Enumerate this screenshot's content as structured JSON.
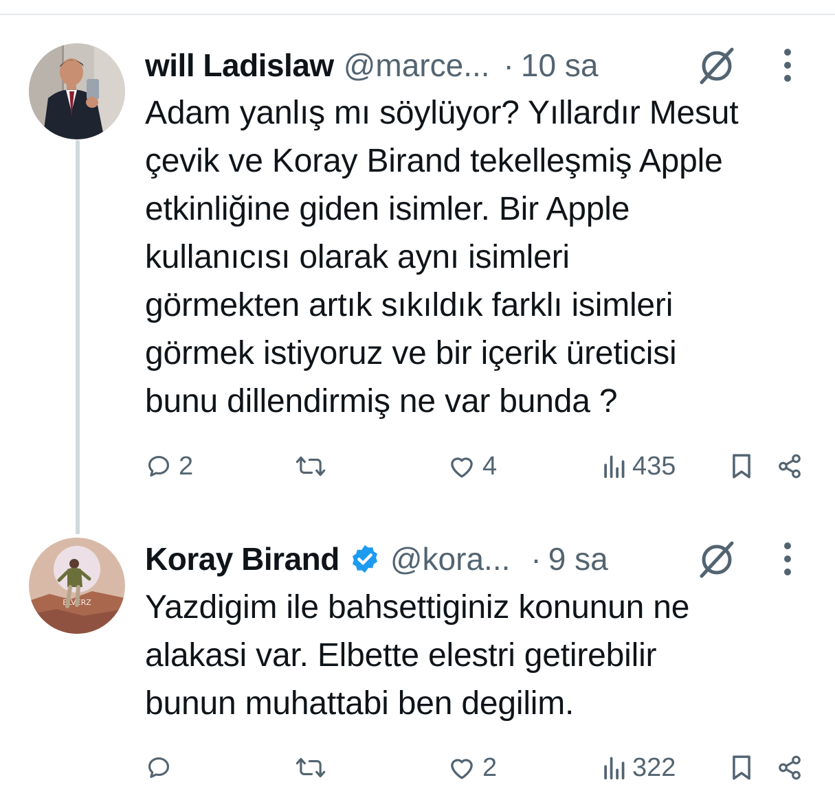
{
  "tweets": [
    {
      "name": "will Ladislaw",
      "handle": "@marce...",
      "dot": "·",
      "time": "10 sa",
      "verified": false,
      "lines": "Adam yanlış mı söylüyor? Yıllardır Mesut\nçevik ve Koray Birand tekelleşmiş Apple\netkinliğine giden isimler. Bir Apple\nkullanıcısı olarak aynı isimleri\ngörmekten artık sıkıldık farklı isimleri\ngörmek istiyoruz ve bir içerik üreticisi\nbunu dillendirmiş ne var bunda ?",
      "replies": "2",
      "retweets": "",
      "likes": "4",
      "views": "435"
    },
    {
      "name": "Koray Birand",
      "handle": "@kora...",
      "dot": "·",
      "time": "9 sa",
      "verified": true,
      "lines": "Yazdigim ile bahsettiginiz konunun ne\nalakasi var. Elbette elestri getirebilir\nbunun muhattabi ben degilim.",
      "replies": "",
      "retweets": "",
      "likes": "2",
      "views": "322"
    }
  ],
  "icons": {
    "reply": "reply-icon",
    "retweet": "retweet-icon",
    "like": "heart-icon",
    "views": "views-icon",
    "bookmark": "bookmark-icon",
    "share": "share-icon",
    "grok": "grok-icon",
    "more": "more-icon",
    "verified": "verified-badge-icon"
  },
  "colors": {
    "text": "#0f1419",
    "secondary": "#536471",
    "verified": "#1d9bf0",
    "thread_line": "#cfd9de"
  }
}
